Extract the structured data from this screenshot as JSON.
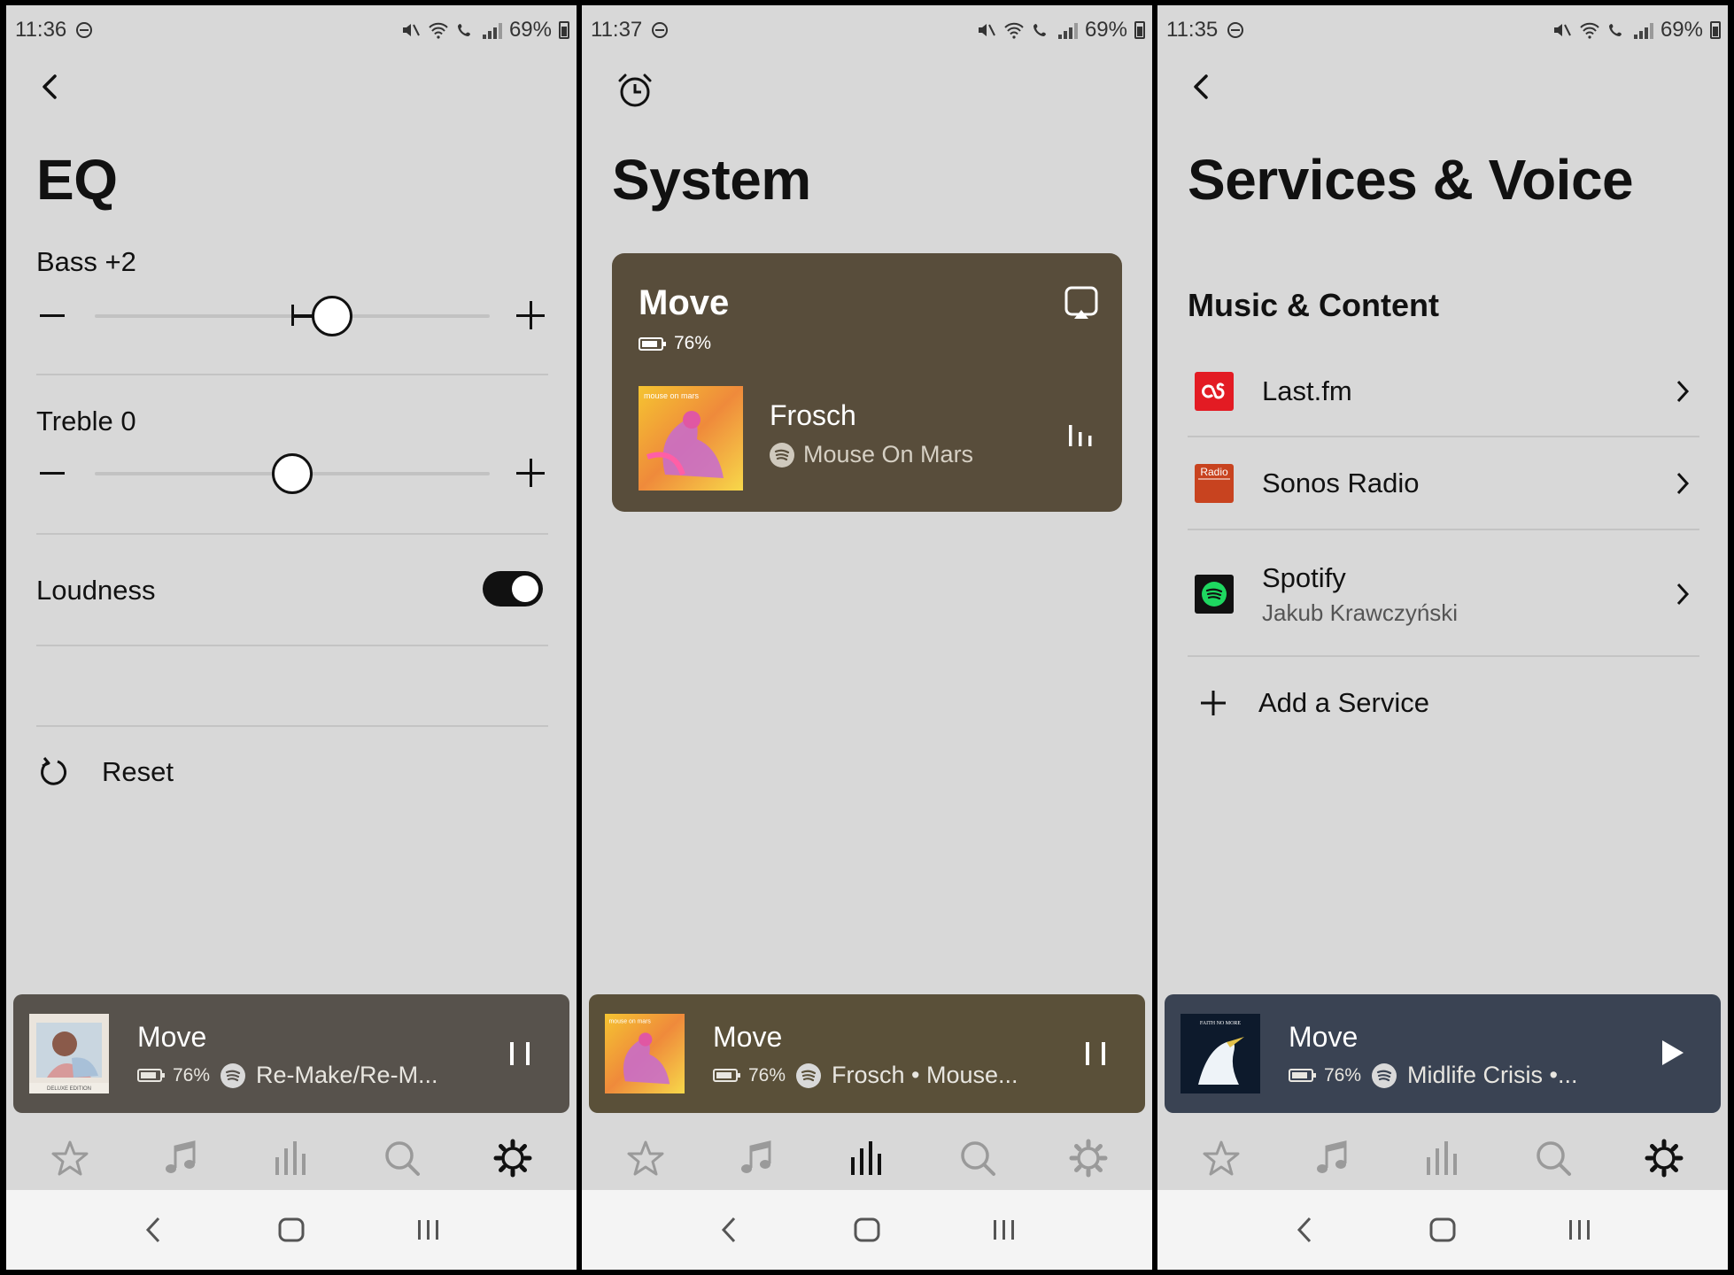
{
  "screens": [
    {
      "status": {
        "time": "11:36",
        "battery": "69%"
      },
      "title": "EQ",
      "bass": {
        "label": "Bass +2",
        "value": 2,
        "min": -10,
        "max": 10
      },
      "treble": {
        "label": "Treble 0",
        "value": 0,
        "min": -10,
        "max": 10
      },
      "loudness": {
        "label": "Loudness",
        "on": true
      },
      "reset": {
        "label": "Reset"
      },
      "mini_player": {
        "name": "Move",
        "battery": "76%",
        "track": "Re-Make/Re-M...",
        "album_text": "DELUXE EDITION",
        "state": "playing",
        "bg": "#57524c"
      },
      "tabs": {
        "active": "settings"
      }
    },
    {
      "status": {
        "time": "11:37",
        "battery": "69%"
      },
      "title": "System",
      "card": {
        "name": "Move",
        "battery": "76%",
        "track_title": "Frosch",
        "artist": "Mouse On Mars",
        "album_text": "mouse on mars"
      },
      "mini_player": {
        "name": "Move",
        "battery": "76%",
        "track": "Frosch • Mouse...",
        "album_text": "mouse on mars",
        "state": "playing",
        "bg": "#5a5039"
      },
      "tabs": {
        "active": "rooms"
      }
    },
    {
      "status": {
        "time": "11:35",
        "battery": "69%"
      },
      "title": "Services & Voice",
      "section": "Music & Content",
      "services": [
        {
          "name": "Last.fm",
          "logo_color": "#e31b23"
        },
        {
          "name": "Sonos Radio",
          "logo_text": "Radio",
          "logo_color": "#c8431f"
        },
        {
          "name": "Spotify",
          "account": "Jakub Krawczyński",
          "logo_color": "#111111"
        }
      ],
      "add_service": "Add a Service",
      "mini_player": {
        "name": "Move",
        "battery": "76%",
        "track": "Midlife Crisis •...",
        "album_text": "FAITH NO MORE",
        "state": "paused",
        "bg": "#3a4353"
      },
      "tabs": {
        "active": "settings"
      }
    }
  ]
}
